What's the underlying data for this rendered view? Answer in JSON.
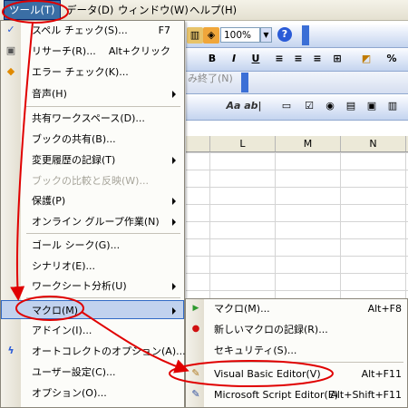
{
  "menubar": {
    "items": [
      {
        "label": "ツール(T)"
      },
      {
        "label": "データ(D)"
      },
      {
        "label": "ウィンドウ(W)"
      },
      {
        "label": "ヘルプ(H)"
      }
    ]
  },
  "toolbar": {
    "zoom_value": "100%",
    "format_buttons": [
      "B",
      "I",
      "U"
    ],
    "percent_label": "%",
    "review_field_text": "み終了(N)",
    "font_style_label": "Aa ab|"
  },
  "grid": {
    "columns": [
      "L",
      "M",
      "N"
    ]
  },
  "tools_menu": {
    "items": [
      {
        "label": "スペル チェック(S)...",
        "shortcut": "F7",
        "icon": "spellcheck-icon"
      },
      {
        "label": "リサーチ(R)...",
        "shortcut": "Alt+クリック",
        "icon": "research-icon"
      },
      {
        "label": "エラー チェック(K)...",
        "icon": "error-check-icon"
      },
      {
        "label": "音声(H)"
      },
      {
        "label": "共有ワークスペース(D)..."
      },
      {
        "label": "ブックの共有(B)..."
      },
      {
        "label": "変更履歴の記録(T)"
      },
      {
        "label": "ブックの比較と反映(W)..."
      },
      {
        "label": "保護(P)"
      },
      {
        "label": "オンライン グループ作業(N)"
      },
      {
        "label": "ゴール シーク(G)..."
      },
      {
        "label": "シナリオ(E)..."
      },
      {
        "label": "ワークシート分析(U)"
      },
      {
        "label": "マクロ(M)"
      },
      {
        "label": "アドイン(I)..."
      },
      {
        "label": "オートコレクトのオプション(A)...",
        "icon": "autocorrect-icon"
      },
      {
        "label": "ユーザー設定(C)..."
      },
      {
        "label": "オプション(O)..."
      }
    ]
  },
  "macro_submenu": {
    "items": [
      {
        "label": "マクロ(M)...",
        "shortcut": "Alt+F8",
        "icon": "play-icon"
      },
      {
        "label": "新しいマクロの記録(R)...",
        "icon": "record-icon"
      },
      {
        "label": "セキュリティ(S)..."
      },
      {
        "label": "Visual Basic Editor(V)",
        "shortcut": "Alt+F11",
        "icon": "vb-editor-icon"
      },
      {
        "label": "Microsoft Script Editor(E)",
        "shortcut": "Alt+Shift+F11",
        "icon": "script-editor-icon"
      }
    ]
  },
  "colors": {
    "annotation": "#e00000",
    "highlight_bg": "#c1d2ee",
    "highlight_border": "#316ac5",
    "toolbar_blue": "#3b6fd6"
  }
}
